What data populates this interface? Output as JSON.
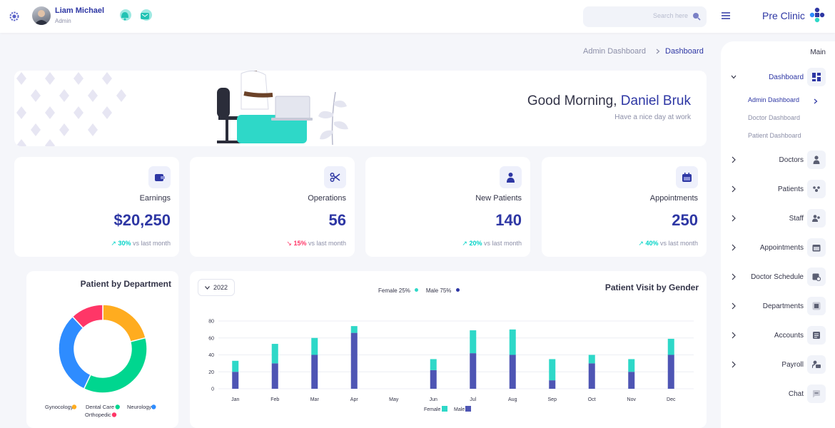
{
  "topbar": {
    "user_name": "Liam Michael",
    "user_role": "Admin",
    "search_placeholder": "Search here",
    "brand": "Pre Clinic"
  },
  "breadcrumb": {
    "parent": "Admin Dashboard",
    "current": "Dashboard"
  },
  "welcome": {
    "greeting": "Good Morning,",
    "name": "Daniel Bruk",
    "subtitle": "Have a nice day at work"
  },
  "stats": [
    {
      "title": "Earnings",
      "value": "$20,250",
      "change": "30%",
      "direction": "up",
      "suffix": "vs last month"
    },
    {
      "title": "Operations",
      "value": "56",
      "change": "15%",
      "direction": "down",
      "suffix": "vs last month"
    },
    {
      "title": "New Patients",
      "value": "140",
      "change": "20%",
      "direction": "up",
      "suffix": "vs last month"
    },
    {
      "title": "Appointments",
      "value": "250",
      "change": "40%",
      "direction": "up",
      "suffix": "vs last month"
    }
  ],
  "sidebar": {
    "section": "Main",
    "dashboard": "Dashboard",
    "sub_items": [
      "Admin Dashboard",
      "Doctor Dashboard",
      "Patient Dashboard"
    ],
    "items": [
      "Doctors",
      "Patients",
      "Staff",
      "Appointments",
      "Doctor Schedule",
      "Departments",
      "Accounts",
      "Payroll",
      "Chat"
    ]
  },
  "colors": {
    "primary": "#2e37a4",
    "teal": "#2ed8c8",
    "indigo": "#4e55b4",
    "up": "#00d3c7",
    "down": "#ff3667"
  },
  "chart_data": [
    {
      "type": "pie",
      "title": "Patient by Department",
      "categories": [
        "Gynocology",
        "Dental Care",
        "Neurology",
        "Orthopedic"
      ],
      "values": [
        21,
        36,
        31,
        12
      ],
      "colors": [
        "#ffac1f",
        "#00d68f",
        "#2e8cff",
        "#ff3667"
      ]
    },
    {
      "type": "bar",
      "title": "Patient Visit by Gender",
      "year": "2022",
      "legend_top": [
        "Female 25%",
        "Male 75%"
      ],
      "categories": [
        "Jan",
        "Feb",
        "Mar",
        "Apr",
        "May",
        "Jun",
        "Jul",
        "Aug",
        "Sep",
        "Oct",
        "Nov",
        "Dec"
      ],
      "series": [
        {
          "name": "Male",
          "values": [
            20,
            30,
            40,
            66,
            0,
            22,
            42,
            40,
            10,
            30,
            20,
            40
          ]
        },
        {
          "name": "Female",
          "values": [
            13,
            23,
            20,
            8,
            0,
            13,
            27,
            30,
            25,
            10,
            15,
            19
          ]
        }
      ],
      "ylim": [
        0,
        80
      ],
      "yticks": [
        0,
        20,
        40,
        60,
        80
      ],
      "grid": true
    }
  ]
}
